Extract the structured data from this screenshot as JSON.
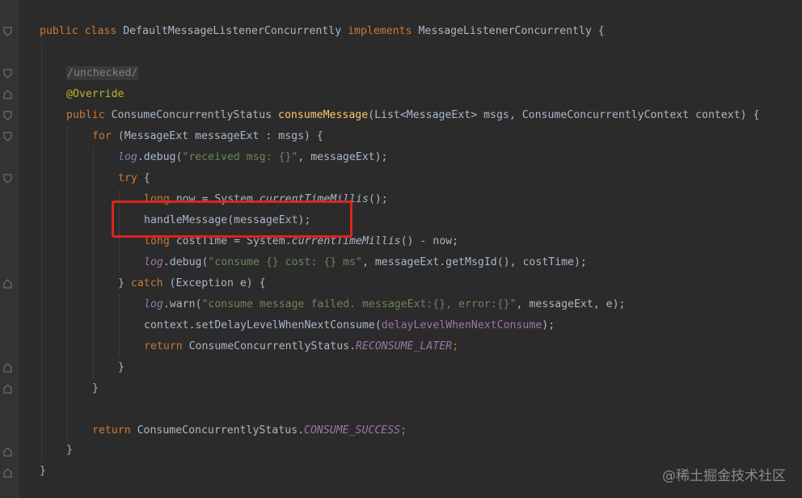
{
  "code": {
    "l01": {
      "t1": "public class ",
      "t2": "DefaultMessageListenerConcurrently ",
      "t3": "implements ",
      "t4": "MessageListenerConcurrently {"
    },
    "l03": {
      "t1": "/unchecked/"
    },
    "l04": {
      "t1": "@Override"
    },
    "l05": {
      "t1": "public ",
      "t2": "ConsumeConcurrentlyStatus ",
      "t3": "consumeMessage",
      "t4": "(List<MessageExt> msgs, ConsumeConcurrentlyContext context) {"
    },
    "l06": {
      "t1": "for ",
      "t2": "(MessageExt messageExt : msgs) {"
    },
    "l07": {
      "t1": "log",
      "t2": ".debug(",
      "t3": "\"received msg: {}\"",
      "t4": ", messageExt);"
    },
    "l08": {
      "t1": "try ",
      "t2": "{"
    },
    "l09": {
      "t1": "long ",
      "t2": "now = System.",
      "t3": "currentTimeMillis",
      "t4": "();"
    },
    "l10": {
      "t1": "handleMessage(messageExt);"
    },
    "l11": {
      "t1": "long ",
      "t2": "costTime = System.",
      "t3": "currentTimeMillis",
      "t4": "() - now;"
    },
    "l12": {
      "t1": "log",
      "t2": ".debug(",
      "t3": "\"consume {} cost: {} ms\"",
      "t4": ", messageExt.getMsgId(), costTime);"
    },
    "l13": {
      "t1": "} ",
      "t2": "catch ",
      "t3": "(Exception e) {"
    },
    "l14": {
      "t1": "log",
      "t2": ".warn(",
      "t3": "\"consume message failed. messageExt:{}, error:{}\"",
      "t4": ", messageExt, e);"
    },
    "l15": {
      "t1": "context.setDelayLevelWhenNextConsume(",
      "t2": "delayLevelWhenNextConsume",
      "t3": ");"
    },
    "l16": {
      "t1": "return ",
      "t2": "ConsumeConcurrentlyStatus.",
      "t3": "RECONSUME_LATER",
      "t4": ";"
    },
    "l17": {
      "t1": "}"
    },
    "l18": {
      "t1": "}"
    },
    "l20": {
      "t1": "return ",
      "t2": "ConsumeConcurrentlyStatus.",
      "t3": "CONSUME_SUCCESS",
      "t4": ";"
    },
    "l21": {
      "t1": "}"
    },
    "l22": {
      "t1": "}"
    }
  },
  "watermark": "@稀土掘金技术社区",
  "colors": {
    "background": "#2b2b2b",
    "keyword": "#cc7832",
    "method": "#ffc66d",
    "annotation": "#bbb529",
    "string": "#6a8759",
    "field": "#9876aa",
    "text": "#a9b7c6",
    "highlight_box": "#e0231d"
  },
  "icons": [
    "fold-marker-icon"
  ]
}
